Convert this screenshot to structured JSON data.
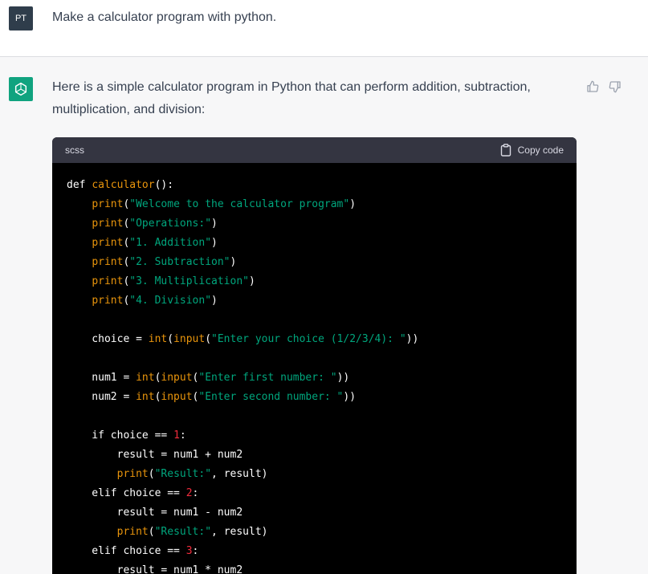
{
  "user": {
    "avatar_initials": "PT",
    "message": "Make a calculator program with python."
  },
  "assistant": {
    "intro_line1": "Here is a simple calculator program in Python that can perform addition, subtraction,",
    "intro_line2": "multiplication, and division:",
    "feedback": {
      "up_icon": "thumbs-up-icon",
      "down_icon": "thumbs-down-icon"
    }
  },
  "code": {
    "language": "scss",
    "copy_label": "Copy code",
    "lines": [
      [
        {
          "t": "def ",
          "c": "k"
        },
        {
          "t": "calculator",
          "c": "fnname"
        },
        {
          "t": "():",
          "c": "pl"
        }
      ],
      [
        {
          "t": "    ",
          "c": "pl"
        },
        {
          "t": "print",
          "c": "bi"
        },
        {
          "t": "(",
          "c": "pl"
        },
        {
          "t": "\"Welcome to the calculator program\"",
          "c": "str"
        },
        {
          "t": ")",
          "c": "pl"
        }
      ],
      [
        {
          "t": "    ",
          "c": "pl"
        },
        {
          "t": "print",
          "c": "bi"
        },
        {
          "t": "(",
          "c": "pl"
        },
        {
          "t": "\"Operations:\"",
          "c": "str"
        },
        {
          "t": ")",
          "c": "pl"
        }
      ],
      [
        {
          "t": "    ",
          "c": "pl"
        },
        {
          "t": "print",
          "c": "bi"
        },
        {
          "t": "(",
          "c": "pl"
        },
        {
          "t": "\"1. Addition\"",
          "c": "str"
        },
        {
          "t": ")",
          "c": "pl"
        }
      ],
      [
        {
          "t": "    ",
          "c": "pl"
        },
        {
          "t": "print",
          "c": "bi"
        },
        {
          "t": "(",
          "c": "pl"
        },
        {
          "t": "\"2. Subtraction\"",
          "c": "str"
        },
        {
          "t": ")",
          "c": "pl"
        }
      ],
      [
        {
          "t": "    ",
          "c": "pl"
        },
        {
          "t": "print",
          "c": "bi"
        },
        {
          "t": "(",
          "c": "pl"
        },
        {
          "t": "\"3. Multiplication\"",
          "c": "str"
        },
        {
          "t": ")",
          "c": "pl"
        }
      ],
      [
        {
          "t": "    ",
          "c": "pl"
        },
        {
          "t": "print",
          "c": "bi"
        },
        {
          "t": "(",
          "c": "pl"
        },
        {
          "t": "\"4. Division\"",
          "c": "str"
        },
        {
          "t": ")",
          "c": "pl"
        }
      ],
      [],
      [
        {
          "t": "    choice = ",
          "c": "pl"
        },
        {
          "t": "int",
          "c": "bi"
        },
        {
          "t": "(",
          "c": "pl"
        },
        {
          "t": "input",
          "c": "bi"
        },
        {
          "t": "(",
          "c": "pl"
        },
        {
          "t": "\"Enter your choice (1/2/3/4): \"",
          "c": "str"
        },
        {
          "t": "))",
          "c": "pl"
        }
      ],
      [],
      [
        {
          "t": "    num1 = ",
          "c": "pl"
        },
        {
          "t": "int",
          "c": "bi"
        },
        {
          "t": "(",
          "c": "pl"
        },
        {
          "t": "input",
          "c": "bi"
        },
        {
          "t": "(",
          "c": "pl"
        },
        {
          "t": "\"Enter first number: \"",
          "c": "str"
        },
        {
          "t": "))",
          "c": "pl"
        }
      ],
      [
        {
          "t": "    num2 = ",
          "c": "pl"
        },
        {
          "t": "int",
          "c": "bi"
        },
        {
          "t": "(",
          "c": "pl"
        },
        {
          "t": "input",
          "c": "bi"
        },
        {
          "t": "(",
          "c": "pl"
        },
        {
          "t": "\"Enter second number: \"",
          "c": "str"
        },
        {
          "t": "))",
          "c": "pl"
        }
      ],
      [],
      [
        {
          "t": "    if choice == ",
          "c": "pl"
        },
        {
          "t": "1",
          "c": "fn"
        },
        {
          "t": ":",
          "c": "pl"
        }
      ],
      [
        {
          "t": "        result = num1 + num2",
          "c": "pl"
        }
      ],
      [
        {
          "t": "        ",
          "c": "pl"
        },
        {
          "t": "print",
          "c": "bi"
        },
        {
          "t": "(",
          "c": "pl"
        },
        {
          "t": "\"Result:\"",
          "c": "str"
        },
        {
          "t": ", result)",
          "c": "pl"
        }
      ],
      [
        {
          "t": "    elif choice == ",
          "c": "pl"
        },
        {
          "t": "2",
          "c": "fn"
        },
        {
          "t": ":",
          "c": "pl"
        }
      ],
      [
        {
          "t": "        result = num1 - num2",
          "c": "pl"
        }
      ],
      [
        {
          "t": "        ",
          "c": "pl"
        },
        {
          "t": "print",
          "c": "bi"
        },
        {
          "t": "(",
          "c": "pl"
        },
        {
          "t": "\"Result:\"",
          "c": "str"
        },
        {
          "t": ", result)",
          "c": "pl"
        }
      ],
      [
        {
          "t": "    elif choice == ",
          "c": "pl"
        },
        {
          "t": "3",
          "c": "fn"
        },
        {
          "t": ":",
          "c": "pl"
        }
      ],
      [
        {
          "t": "        result = num1 * num2",
          "c": "pl"
        }
      ]
    ]
  }
}
